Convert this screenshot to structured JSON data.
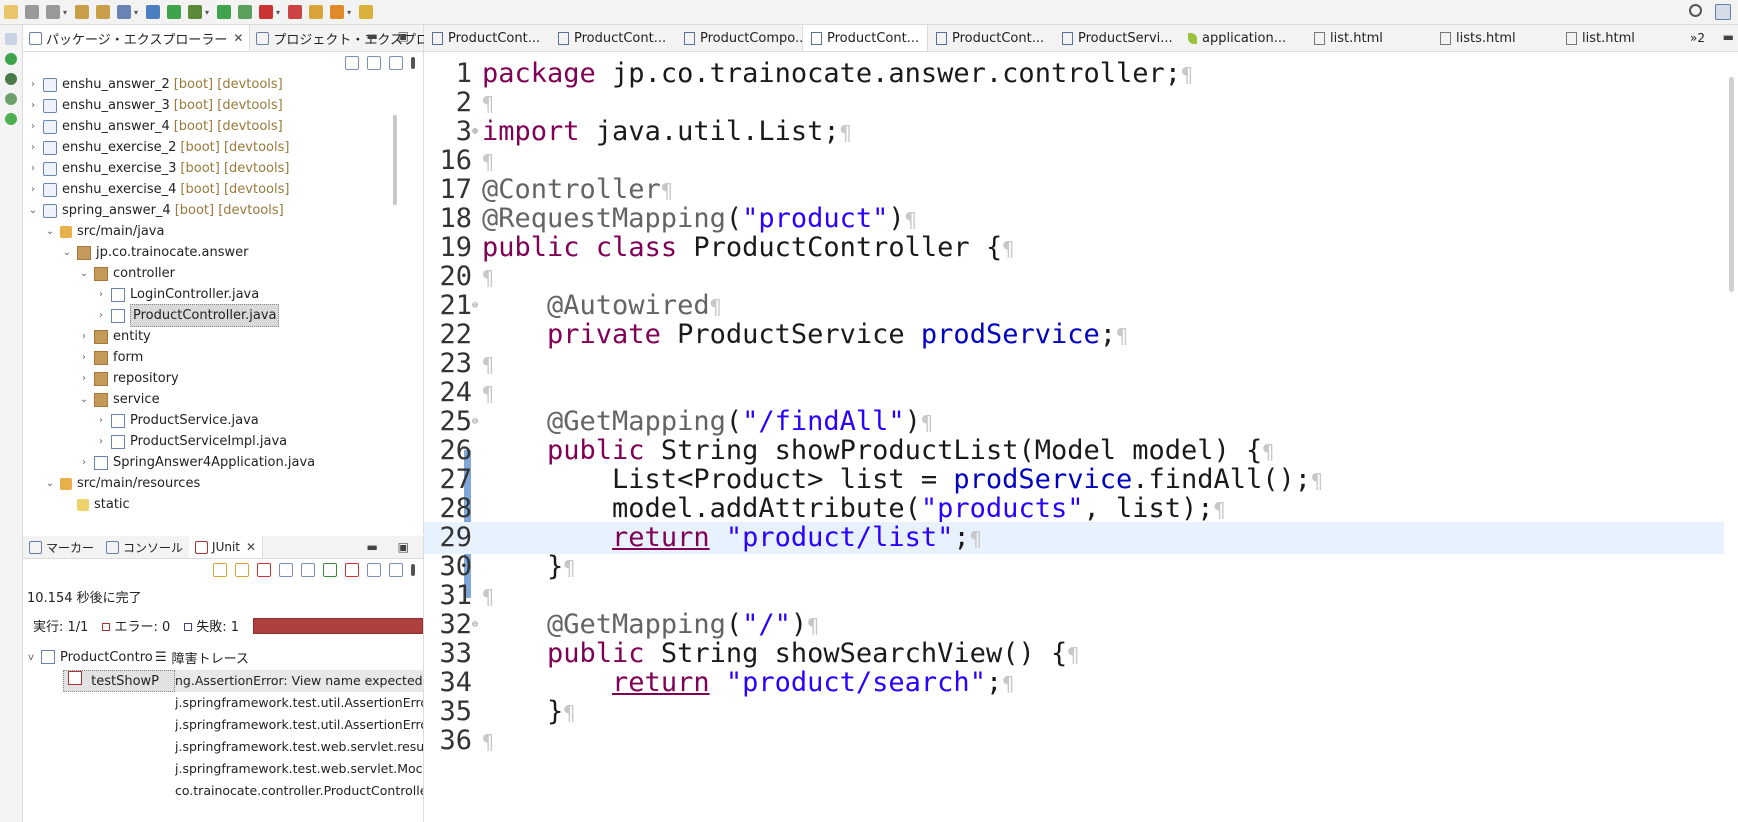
{
  "toolbar": {
    "icons": [
      "new-icon",
      "save-icon",
      "save-all-icon",
      "undo-icon",
      "redo-icon",
      "open-type-icon",
      "settings-icon",
      "spring-icon",
      "debug-icon",
      "run-icon",
      "run-config-icon",
      "stop-icon",
      "external-tools-icon",
      "new-project-icon",
      "new-class-icon",
      "open-folder-icon",
      "search-icon",
      "perspective-icon"
    ]
  },
  "package_explorer": {
    "tab_label": "パッケージ・エクスプローラー",
    "tab2_label": "プロジェクト・エクスプロー...",
    "tree": [
      {
        "label": "enshu_answer_2",
        "deco": "[boot] [devtools]",
        "depth": 0,
        "twisty": ">",
        "icon": "project"
      },
      {
        "label": "enshu_answer_3",
        "deco": "[boot] [devtools]",
        "depth": 0,
        "twisty": ">",
        "icon": "project"
      },
      {
        "label": "enshu_answer_4",
        "deco": "[boot] [devtools]",
        "depth": 0,
        "twisty": ">",
        "icon": "project"
      },
      {
        "label": "enshu_exercise_2",
        "deco": "[boot] [devtools]",
        "depth": 0,
        "twisty": ">",
        "icon": "project"
      },
      {
        "label": "enshu_exercise_3",
        "deco": "[boot] [devtools]",
        "depth": 0,
        "twisty": ">",
        "icon": "project"
      },
      {
        "label": "enshu_exercise_4",
        "deco": "[boot] [devtools]",
        "depth": 0,
        "twisty": ">",
        "icon": "project"
      },
      {
        "label": "spring_answer_4",
        "deco": "[boot] [devtools]",
        "depth": 0,
        "twisty": "v",
        "icon": "project"
      },
      {
        "label": "src/main/java",
        "deco": "",
        "depth": 1,
        "twisty": "v",
        "icon": "srcfolder"
      },
      {
        "label": "jp.co.trainocate.answer",
        "deco": "",
        "depth": 2,
        "twisty": "v",
        "icon": "package"
      },
      {
        "label": "controller",
        "deco": "",
        "depth": 3,
        "twisty": "v",
        "icon": "package"
      },
      {
        "label": "LoginController.java",
        "deco": "",
        "depth": 4,
        "twisty": ">",
        "icon": "java"
      },
      {
        "label": "ProductController.java",
        "deco": "",
        "depth": 4,
        "twisty": ">",
        "icon": "java",
        "selected": true
      },
      {
        "label": "entity",
        "deco": "",
        "depth": 3,
        "twisty": ">",
        "icon": "package"
      },
      {
        "label": "form",
        "deco": "",
        "depth": 3,
        "twisty": ">",
        "icon": "package"
      },
      {
        "label": "repository",
        "deco": "",
        "depth": 3,
        "twisty": ">",
        "icon": "package"
      },
      {
        "label": "service",
        "deco": "",
        "depth": 3,
        "twisty": "v",
        "icon": "package"
      },
      {
        "label": "ProductService.java",
        "deco": "",
        "depth": 4,
        "twisty": ">",
        "icon": "java"
      },
      {
        "label": "ProductServiceImpl.java",
        "deco": "",
        "depth": 4,
        "twisty": ">",
        "icon": "java"
      },
      {
        "label": "SpringAnswer4Application.java",
        "deco": "",
        "depth": 3,
        "twisty": ">",
        "icon": "java"
      },
      {
        "label": "src/main/resources",
        "deco": "",
        "depth": 1,
        "twisty": "v",
        "icon": "srcfolder"
      },
      {
        "label": "static",
        "deco": "",
        "depth": 2,
        "twisty": "",
        "icon": "folder"
      }
    ]
  },
  "junit": {
    "tab_markers": "マーカー",
    "tab_console": "コンソール",
    "tab_junit": "JUnit",
    "finished_text": "10.154 秒後に完了",
    "runs_label": "実行:",
    "runs_value": "1/1",
    "errors_label": "エラー:",
    "errors_value": "0",
    "failures_label": "失敗:",
    "failures_value": "1",
    "test_class": "ProductContro",
    "test_method": "testShowP",
    "trace_header": "障害トレース",
    "trace_lines": [
      "ng.AssertionError: View name expected:<pro",
      "j.springframework.test.util.AssertionErrors.fai",
      "j.springframework.test.util.AssertionErrors.ass",
      "j.springframework.test.web.servlet.result.View",
      "j.springframework.test.web.servlet.MockMvc$",
      "co.trainocate.controller.ProductControllerTest"
    ]
  },
  "editor": {
    "tabs": [
      {
        "label": "ProductCont...",
        "icon": "java",
        "active": false
      },
      {
        "label": "ProductCont...",
        "icon": "java",
        "active": false
      },
      {
        "label": "ProductCompo...",
        "icon": "java",
        "active": false
      },
      {
        "label": "ProductCont...",
        "icon": "java",
        "active": true
      },
      {
        "label": "ProductCont...",
        "icon": "java",
        "active": false
      },
      {
        "label": "ProductServi...",
        "icon": "java",
        "active": false
      },
      {
        "label": "application...",
        "icon": "leaf",
        "active": false
      },
      {
        "label": "list.html",
        "icon": "doc",
        "active": false
      },
      {
        "label": "lists.html",
        "icon": "doc",
        "active": false
      },
      {
        "label": "list.html",
        "icon": "doc",
        "active": false
      }
    ],
    "tabs_more": "»2",
    "lines": [
      {
        "n": "1",
        "text": "package jp.co.trainocate.answer.controller;"
      },
      {
        "n": "2",
        "text": ""
      },
      {
        "n": "3",
        "text": "import java.util.List;"
      },
      {
        "n": "16",
        "text": ""
      },
      {
        "n": "17",
        "text": "@Controller"
      },
      {
        "n": "18",
        "text": "@RequestMapping(\"product\")"
      },
      {
        "n": "19",
        "text": "public class ProductController {"
      },
      {
        "n": "20",
        "text": ""
      },
      {
        "n": "21",
        "text": "    @Autowired"
      },
      {
        "n": "22",
        "text": "    private ProductService prodService;"
      },
      {
        "n": "23",
        "text": ""
      },
      {
        "n": "24",
        "text": ""
      },
      {
        "n": "25",
        "text": "    @GetMapping(\"/findAll\")"
      },
      {
        "n": "26",
        "text": "    public String showProductList(Model model) {"
      },
      {
        "n": "27",
        "text": "        List<Product> list = prodService.findAll();"
      },
      {
        "n": "28",
        "text": "        model.addAttribute(\"products\", list);"
      },
      {
        "n": "29",
        "text": "        return \"product/list\";"
      },
      {
        "n": "30",
        "text": "    }"
      },
      {
        "n": "31",
        "text": ""
      },
      {
        "n": "32",
        "text": "    @GetMapping(\"/\")"
      },
      {
        "n": "33",
        "text": "    public String showSearchView() {"
      },
      {
        "n": "34",
        "text": "        return \"product/search\";"
      },
      {
        "n": "35",
        "text": "    }"
      },
      {
        "n": "36",
        "text": ""
      }
    ]
  },
  "colors": {
    "keyword": "#7f0055",
    "string": "#2a00ff",
    "field": "#0000c0",
    "annotation": "#646464",
    "failure_bar": "#b04040",
    "current_line": "#e8f2fe"
  }
}
